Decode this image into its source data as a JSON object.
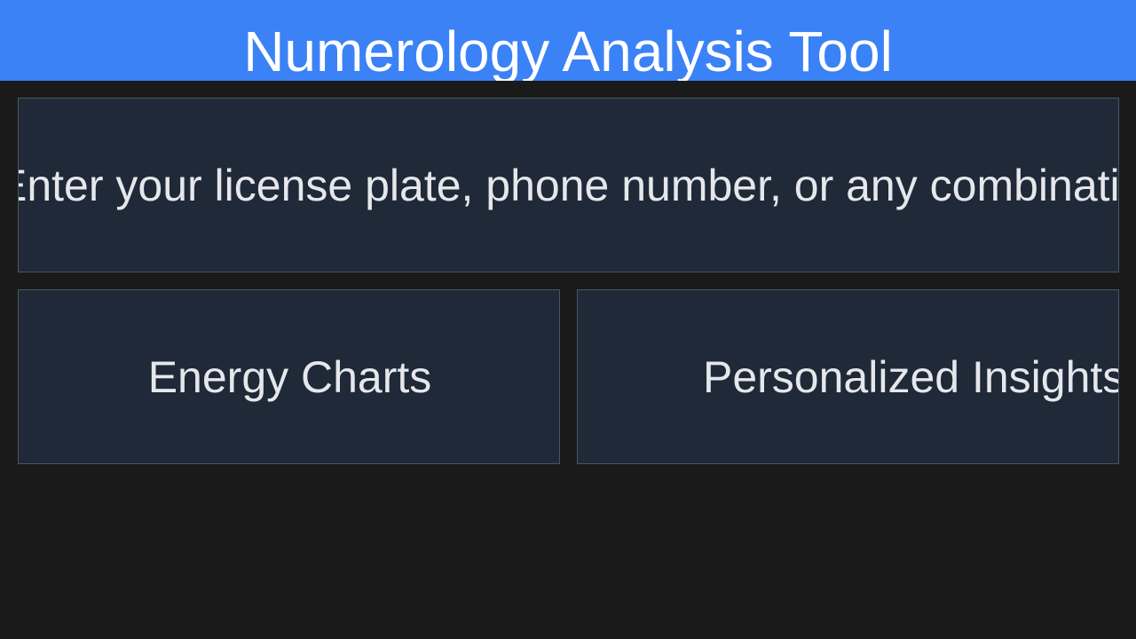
{
  "header": {
    "title": "Numerology Analysis Tool"
  },
  "input_panel": {
    "prompt": "Enter your license plate, phone number, or any combination"
  },
  "features": {
    "energy_charts_label": "Energy Charts",
    "insights_label": "Personalized Insights"
  },
  "colors": {
    "header_bg": "#3b82f6",
    "page_bg": "#1a1a1a",
    "card_bg": "#1f2937",
    "card_border": "#4b5563",
    "text": "#e5e7eb"
  }
}
